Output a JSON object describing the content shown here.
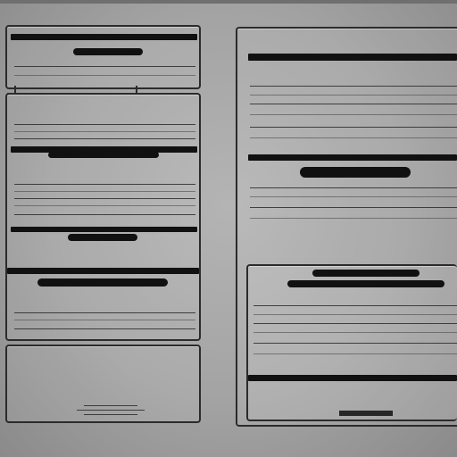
{
  "left_column": {
    "panel1": {
      "header": "",
      "subheader": ""
    },
    "panel2": {
      "title": "",
      "caption": "",
      "footer_label": "",
      "footer_sub": ""
    },
    "panel3": {
      "caption": ""
    },
    "panel4": {
      "emblem": ""
    }
  },
  "right_column": {
    "logo": "",
    "subheader": "",
    "section_title": "",
    "section_label": "",
    "section_banner": "",
    "section_caption": "",
    "footer_label": ""
  }
}
